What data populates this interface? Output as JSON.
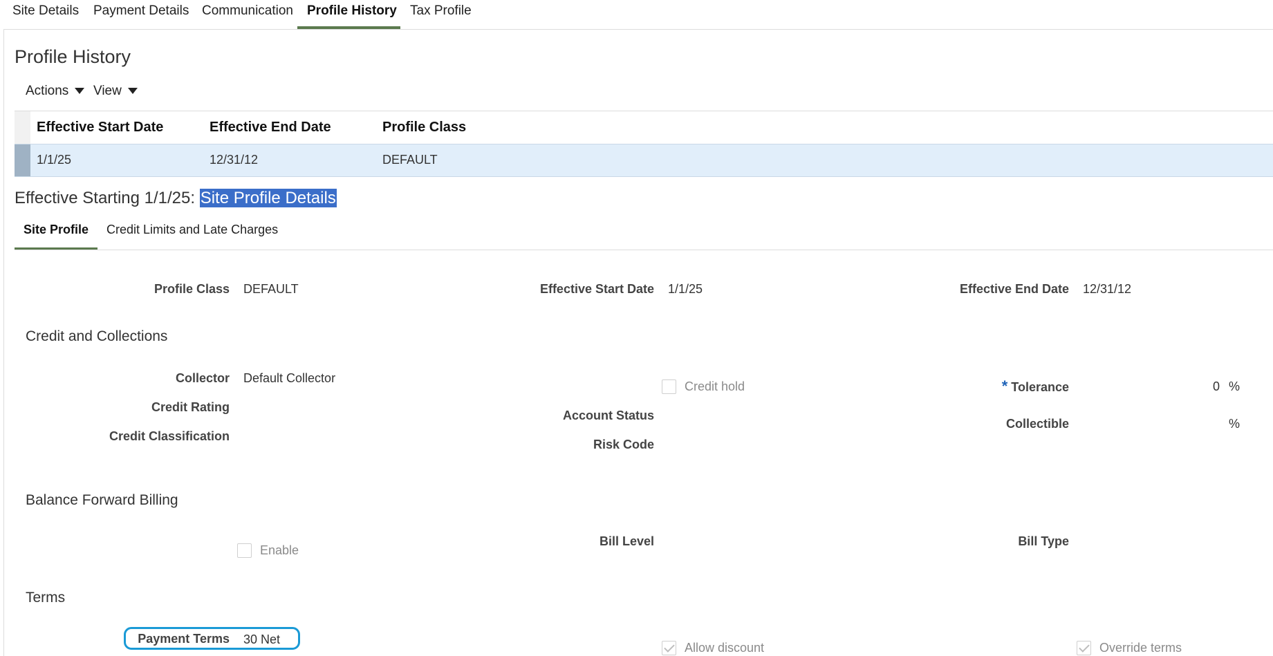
{
  "top_tabs": [
    "Site Details",
    "Payment Details",
    "Communication",
    "Profile History",
    "Tax Profile"
  ],
  "page_title": "Profile History",
  "toolbar": {
    "actions": "Actions",
    "view": "View"
  },
  "table": {
    "headers": [
      "Effective Start Date",
      "Effective End Date",
      "Profile Class"
    ],
    "rows": [
      [
        "1/1/25",
        "12/31/12",
        "DEFAULT"
      ]
    ]
  },
  "section": {
    "prefix": "Effective Starting 1/1/25: ",
    "highlight": "Site Profile Details"
  },
  "sub_tabs": [
    "Site Profile",
    "Credit Limits and Late Charges"
  ],
  "summary": {
    "profile_class_label": "Profile Class",
    "profile_class_value": "DEFAULT",
    "start_label": "Effective Start Date",
    "start_value": "1/1/25",
    "end_label": "Effective End Date",
    "end_value": "12/31/12"
  },
  "credit": {
    "heading": "Credit and Collections",
    "collector_label": "Collector",
    "collector_value": "Default Collector",
    "rating_label": "Credit Rating",
    "classification_label": "Credit Classification",
    "credit_hold_label": "Credit hold",
    "account_status_label": "Account Status",
    "risk_code_label": "Risk Code",
    "required_mark": "*",
    "tolerance_label": "Tolerance",
    "tolerance_value": "0",
    "tolerance_unit": "%",
    "collectible_label": "Collectible",
    "collectible_unit": "%"
  },
  "billing": {
    "heading": "Balance Forward Billing",
    "enable_label": "Enable",
    "bill_level_label": "Bill Level",
    "bill_type_label": "Bill Type"
  },
  "terms": {
    "heading": "Terms",
    "payment_terms_label": "Payment Terms",
    "payment_terms_value": "30 Net",
    "allow_discount_label": "Allow discount",
    "override_terms_label": "Override terms"
  },
  "colors": {
    "accent_underline": "#5b7a4e",
    "row_selected": "#e1eefa",
    "highlight": "#3b6ec9",
    "focus_ring": "#1a9ad6",
    "required": "#1e63b8"
  }
}
